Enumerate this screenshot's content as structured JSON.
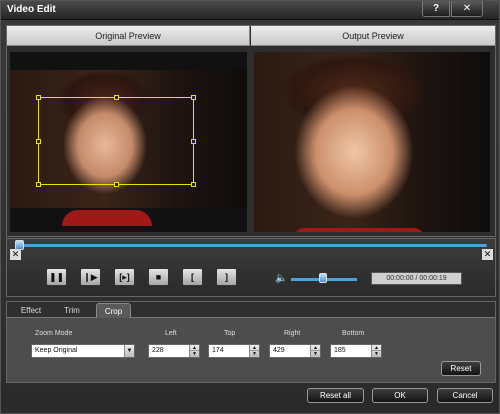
{
  "window": {
    "title": "Video Edit",
    "help_glyph": "?",
    "close_glyph": "✕"
  },
  "preview": {
    "original_label": "Original Preview",
    "output_label": "Output Preview"
  },
  "player": {
    "play_pause_glyph": "❚❚",
    "next_frame_glyph": "❙▶",
    "step_glyph": "[▸]",
    "stop_glyph": "■",
    "mark_in_glyph": "[",
    "mark_out_glyph": "]",
    "volume_glyph": "🔈",
    "time": "00:00:00 / 00:00:19",
    "seek_fraction": 0.0,
    "volume_fraction": 0.45
  },
  "tabs": [
    {
      "label": "Effect"
    },
    {
      "label": "Trim"
    },
    {
      "label": "Crop",
      "active": true
    }
  ],
  "crop": {
    "zoom_mode_label": "Zoom Mode",
    "zoom_mode_value": "Keep Original",
    "left_label": "Left",
    "left_value": "228",
    "top_label": "Top",
    "top_value": "174",
    "right_label": "Right",
    "right_value": "429",
    "bottom_label": "Bottom",
    "bottom_value": "185",
    "reset_label": "Reset"
  },
  "footer": {
    "reset_all_label": "Reset all",
    "ok_label": "OK",
    "cancel_label": "Cancel"
  },
  "colors": {
    "accent": "#4aa3e0",
    "crop_box": "#e4e400"
  }
}
